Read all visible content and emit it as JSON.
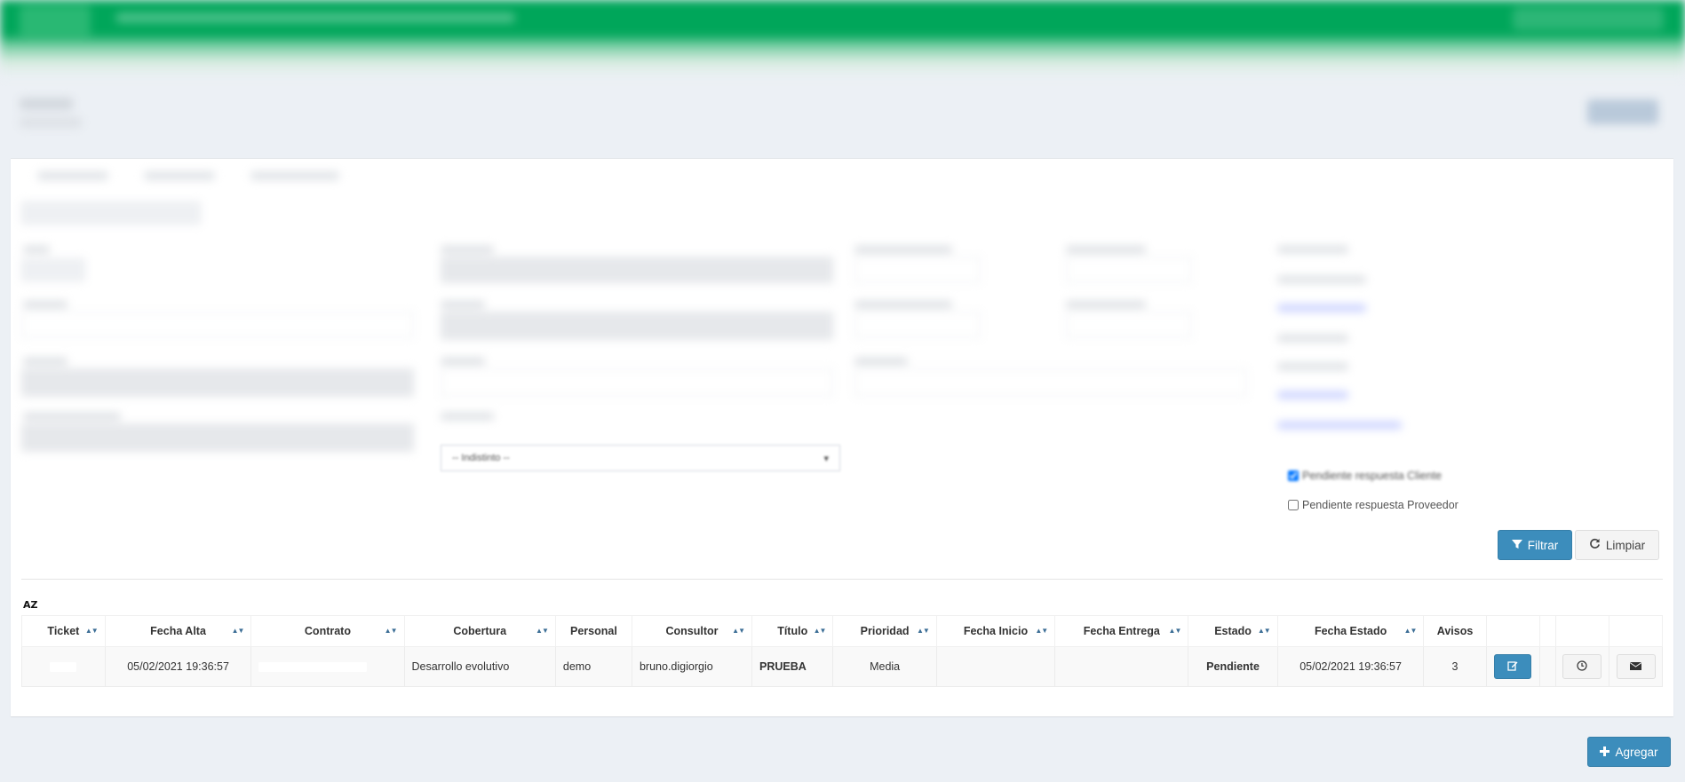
{
  "status_filters": [
    {
      "label": "Pendiente respuesta Cliente",
      "checked": true
    },
    {
      "label": "Pendiente respuesta Proveedor",
      "checked": false
    }
  ],
  "filters": {
    "select_placeholder": "-- Indistinto --"
  },
  "buttons": {
    "filtrar": "Filtrar",
    "limpiar": "Limpiar",
    "agregar": "Agregar"
  },
  "sort_toggle": "AZ",
  "table": {
    "headers": [
      "Ticket",
      "Fecha Alta",
      "Contrato",
      "Cobertura",
      "Personal",
      "Consultor",
      "Título",
      "Prioridad",
      "Fecha Inicio",
      "Fecha Entrega",
      "Estado",
      "Fecha Estado",
      "Avisos"
    ],
    "rows": [
      {
        "ticket": "",
        "fecha_alta": "05/02/2021 19:36:57",
        "contrato": "",
        "cobertura": "Desarrollo evolutivo",
        "personal": "demo",
        "consultor": "bruno.digiorgio",
        "titulo": "PRUEBA",
        "prioridad": "Media",
        "fecha_inicio": "",
        "fecha_entrega": "",
        "estado": "Pendiente",
        "fecha_estado": "05/02/2021 19:36:57",
        "avisos": "3"
      }
    ]
  },
  "colors": {
    "header_green": "#00a65a",
    "primary": "#3c8dbc",
    "background": "#ecf0f5"
  },
  "icons": [
    "filter-icon",
    "refresh-icon",
    "edit-icon",
    "clock-icon",
    "envelope-icon",
    "plus-icon",
    "sort-icon"
  ]
}
